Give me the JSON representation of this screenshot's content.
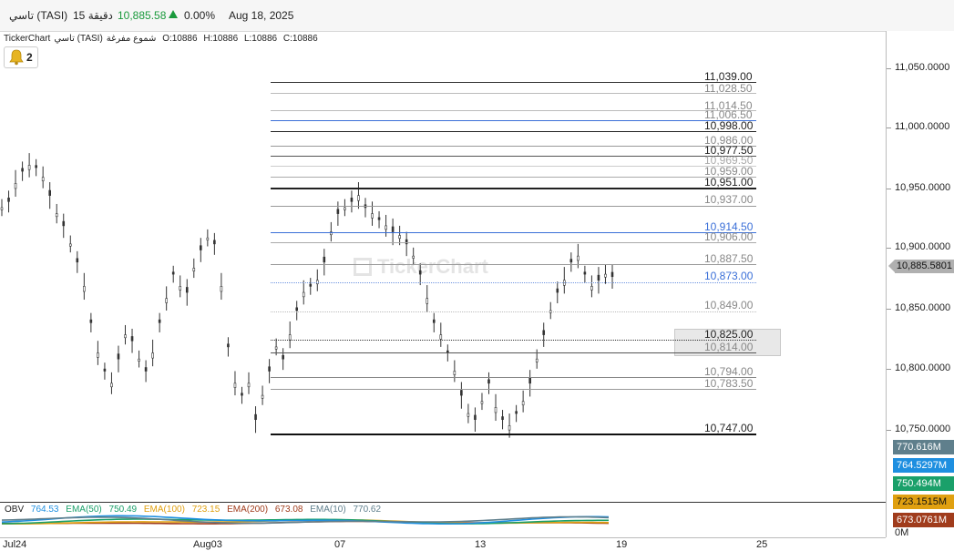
{
  "header": {
    "symbol": "تاسي (TASI)",
    "interval": "15 دقيقة",
    "price": "10,885.58",
    "change_pct": "0.00%",
    "date": "Aug 18, 2025"
  },
  "chart_info": {
    "source": "TickerChart",
    "name": "تاسي (TASI)",
    "type": "شموع مفرغة",
    "o": "O:10886",
    "h": "H:10886",
    "l": "L:10886",
    "c": "C:10886"
  },
  "alerts": {
    "count": "2"
  },
  "watermark": "TickerChart",
  "price_axis": [
    "11,050.0000",
    "11,000.0000",
    "10,950.0000",
    "10,900.0000",
    "10,850.0000",
    "10,800.0000",
    "10,750.0000"
  ],
  "current_price": "10,885.5801",
  "levels": [
    {
      "label": "11,039.00",
      "color": "#222222",
      "line": "#333333"
    },
    {
      "label": "11,028.50",
      "color": "#888888",
      "line": "#bbbbbb"
    },
    {
      "label": "11,014.50",
      "color": "#888888",
      "line": "#bbbbbb"
    },
    {
      "label": "11,006.50",
      "color": "#888888",
      "line": "#3a6fd8"
    },
    {
      "label": "10,998.00",
      "color": "#222222",
      "line": "#222222"
    },
    {
      "label": "10,986.00",
      "color": "#888888",
      "line": "#999999"
    },
    {
      "label": "10,977.50",
      "color": "#222222",
      "line": "#555555"
    },
    {
      "label": "10,969.50",
      "color": "#aaaaaa",
      "line": "#cccccc"
    },
    {
      "label": "10,959.00",
      "color": "#888888",
      "line": "#aaaaaa"
    },
    {
      "label": "10,951.00",
      "color": "#222222",
      "line": "#222222"
    },
    {
      "label": "10,937.00",
      "color": "#888888",
      "line": "#999999"
    },
    {
      "label": "10,914.50",
      "color": "#3a6fd8",
      "line": "#3a6fd8"
    },
    {
      "label": "10,906.00",
      "color": "#888888",
      "line": "#aaaaaa"
    },
    {
      "label": "10,887.50",
      "color": "#888888",
      "line": "#999999"
    },
    {
      "label": "10,873.00",
      "color": "#3a6fd8",
      "line": "#6f95e0"
    },
    {
      "label": "10,849.00",
      "color": "#888888",
      "line": "#bbbbbb"
    },
    {
      "label": "10,825.00",
      "color": "#222222",
      "line": "#333333"
    },
    {
      "label": "10,814.00",
      "color": "#888888",
      "line": "#555555"
    },
    {
      "label": "10,794.00",
      "color": "#888888",
      "line": "#888888"
    },
    {
      "label": "10,783.50",
      "color": "#888888",
      "line": "#999999"
    },
    {
      "label": "10,747.00",
      "color": "#222222",
      "line": "#111111"
    }
  ],
  "obv": {
    "title": "OBV",
    "obv_value": "764.53",
    "ema50_label": "EMA(50)",
    "ema50_value": "750.49",
    "ema100_label": "EMA(100)",
    "ema100_value": "723.15",
    "ema200_label": "EMA(200)",
    "ema200_value": "673.08",
    "ema10_label": "EMA(10)",
    "ema10_value": "770.62",
    "axis_boxes": [
      {
        "label": "770.616M",
        "color": "#5f7f8c"
      },
      {
        "label": "764.5297M",
        "color": "#1e8fe0"
      },
      {
        "label": "750.494M",
        "color": "#1aa06a"
      },
      {
        "label": "723.1515M",
        "color": "#e0a010"
      },
      {
        "label": "673.0761M",
        "color": "#a03c1c"
      }
    ],
    "zero_label": "0M",
    "colors": {
      "obv": "#1e8fe0",
      "ema50": "#1aa06a",
      "ema100": "#e0a010",
      "ema200": "#a03c1c",
      "ema10": "#5f7f8c"
    }
  },
  "x_axis": [
    "Jul24",
    "Aug03",
    "07",
    "13",
    "19",
    "25"
  ],
  "colors": {
    "up": "#1a9a3c",
    "candle": "#333333"
  }
}
